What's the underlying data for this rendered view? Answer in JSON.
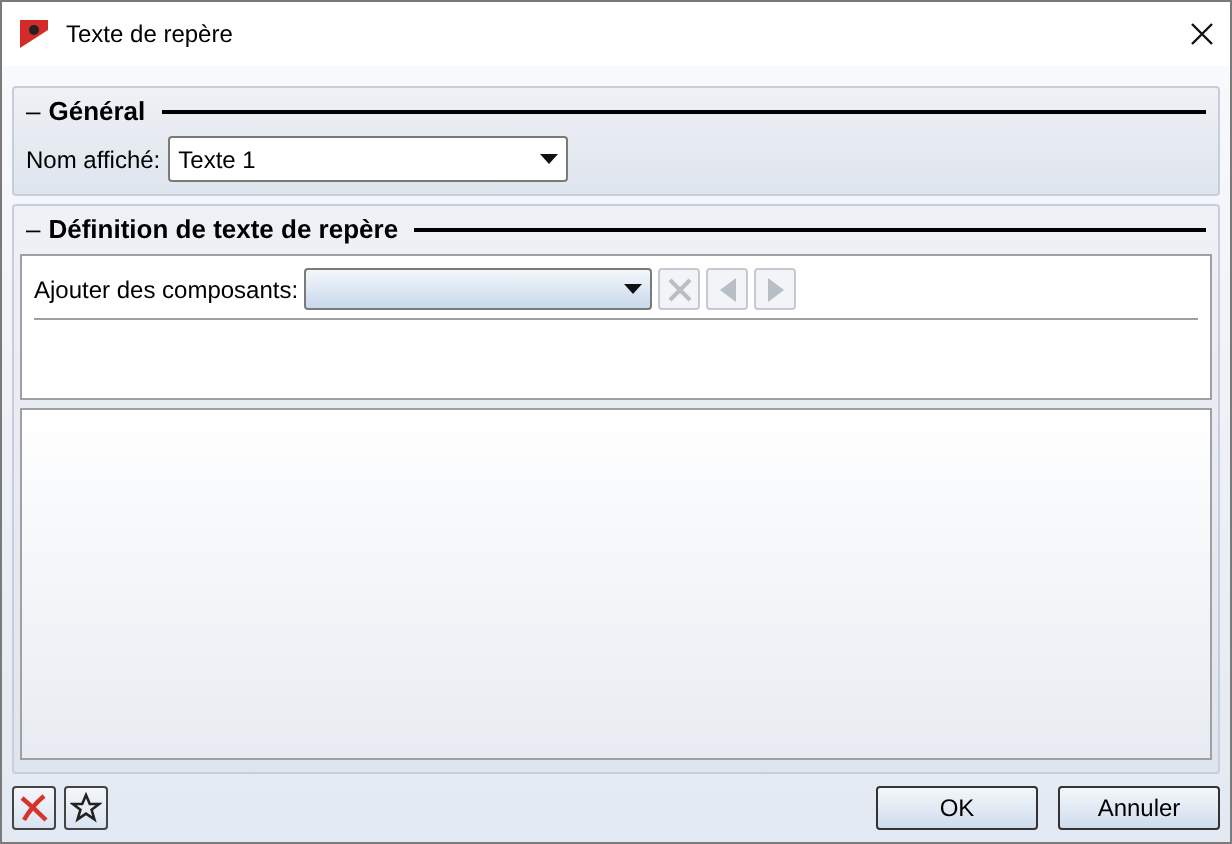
{
  "window": {
    "title": "Texte de repère"
  },
  "general": {
    "toggle": "–",
    "title": "Général",
    "label": "Nom affiché:",
    "value": "Texte 1"
  },
  "definition": {
    "toggle": "–",
    "title": "Définition de texte de repère",
    "label": "Ajouter des composants:",
    "tools": [
      {
        "kind": "delete",
        "disabled": true
      },
      {
        "kind": "left",
        "disabled": true
      },
      {
        "kind": "right",
        "disabled": true
      }
    ]
  },
  "footer": {
    "tools": [
      {
        "kind": "delete"
      },
      {
        "kind": "favorite"
      }
    ],
    "buttons": [
      "OK",
      "Annuler"
    ]
  }
}
